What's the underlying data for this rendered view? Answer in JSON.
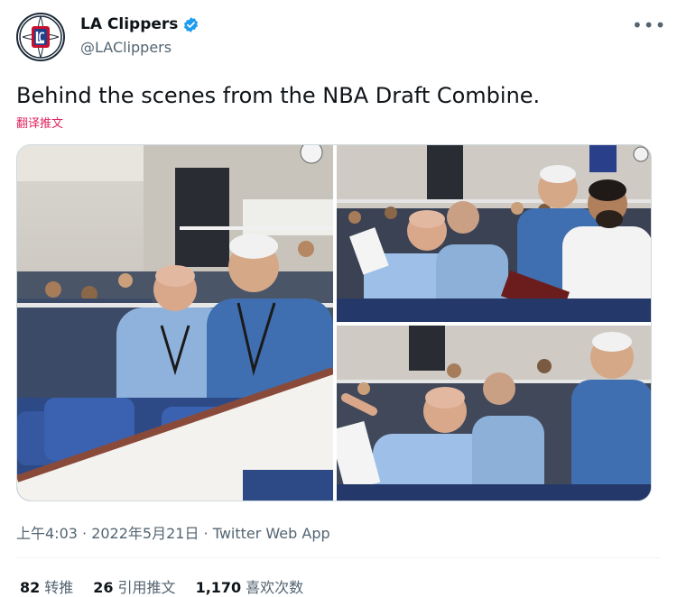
{
  "tweet": {
    "author_name": "LA Clippers",
    "author_handle": "@LAClippers",
    "more_icon": "more-horizontal-icon",
    "verified_icon": "verified-badge-icon",
    "text": "Behind the scenes from the NBA Draft Combine.",
    "translate_label": "翻译推文",
    "media": [
      {
        "name": "photo-1"
      },
      {
        "name": "photo-2"
      },
      {
        "name": "photo-3"
      }
    ],
    "timestamp": "上午4:03 · 2022年5月21日 · Twitter Web App",
    "stats": {
      "retweets_count": "82",
      "retweets_label": "转推",
      "quotes_count": "26",
      "quotes_label": "引用推文",
      "likes_count": "1,170",
      "likes_label": "喜欢次数"
    }
  },
  "colors": {
    "text_primary": "#0f1419",
    "text_secondary": "#536471",
    "verified_blue": "#1d9bf0",
    "translate_link": "#e0245e",
    "border": "#cfd9de",
    "clippers_red": "#c8102e",
    "clippers_blue": "#1d428a"
  }
}
